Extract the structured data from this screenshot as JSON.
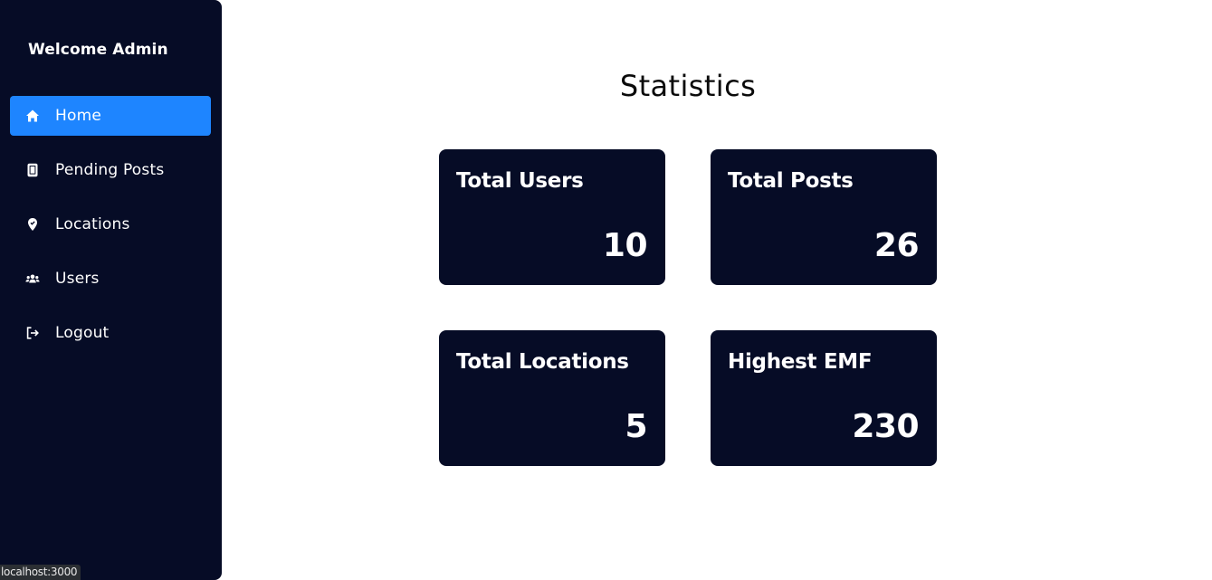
{
  "sidebar": {
    "welcome": "Welcome Admin",
    "items": [
      {
        "label": "Home",
        "icon": "home-icon",
        "active": true
      },
      {
        "label": "Pending Posts",
        "icon": "document-icon",
        "active": false
      },
      {
        "label": "Locations",
        "icon": "location-pin-icon",
        "active": false
      },
      {
        "label": "Users",
        "icon": "users-icon",
        "active": false
      },
      {
        "label": "Logout",
        "icon": "logout-icon",
        "active": false
      }
    ]
  },
  "status_bar": {
    "url": "localhost:3000"
  },
  "main": {
    "title": "Statistics",
    "cards": [
      {
        "title": "Total Users",
        "value": "10"
      },
      {
        "title": "Total Posts",
        "value": "26"
      },
      {
        "title": "Total Locations",
        "value": "5"
      },
      {
        "title": "Highest EMF",
        "value": "230"
      }
    ]
  },
  "colors": {
    "sidebar_bg": "#060c26",
    "active_item": "#1e85ff",
    "card_bg": "#060c26",
    "text_light": "#ffffff",
    "title_text": "#0a0a0a"
  }
}
